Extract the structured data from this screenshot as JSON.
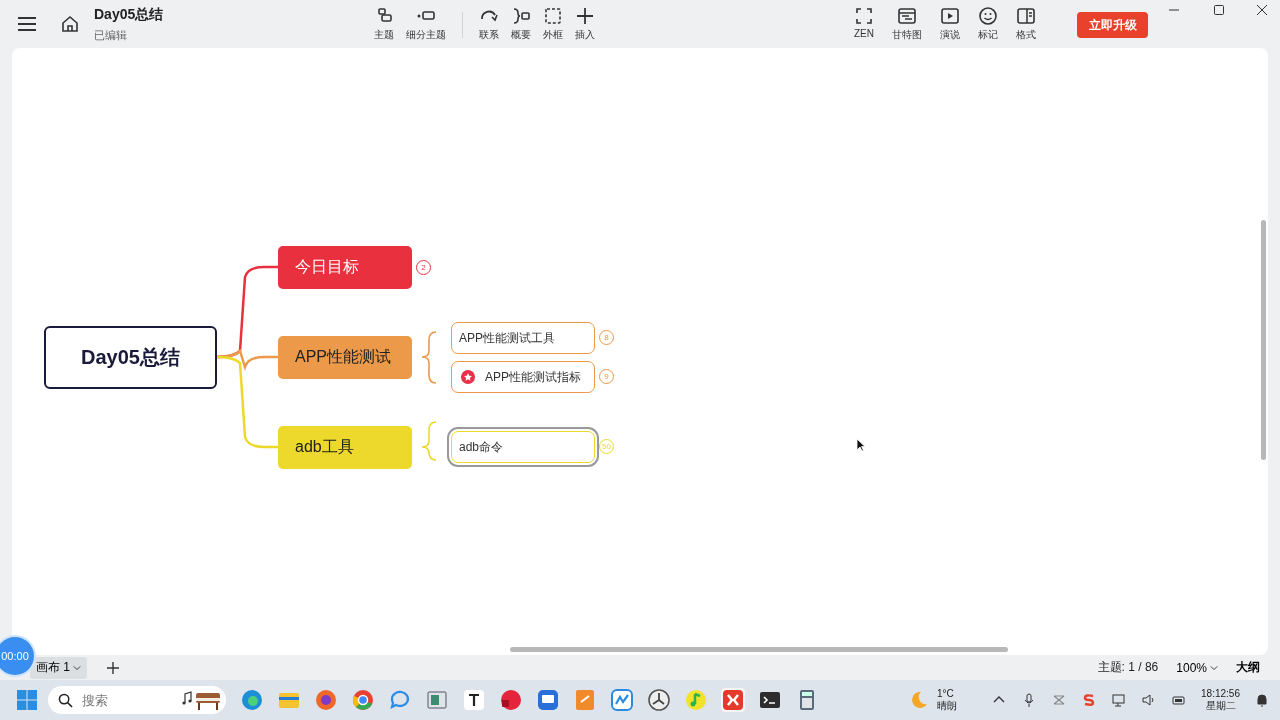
{
  "window": {
    "title": "Day05总结",
    "subtitle": "已编辑"
  },
  "toolbar": {
    "groups": [
      [
        {
          "label": "主题"
        },
        {
          "label": "细分主题"
        }
      ],
      [
        {
          "label": "联系"
        },
        {
          "label": "概要"
        },
        {
          "label": "外框"
        },
        {
          "label": "插入"
        }
      ]
    ]
  },
  "right_tools": [
    {
      "label": "ZEN"
    },
    {
      "label": "甘特图"
    },
    {
      "label": "演说"
    },
    {
      "label": "标记"
    },
    {
      "label": "格式"
    }
  ],
  "upgrade_button": "立即升级",
  "mindmap": {
    "root": "Day05总结",
    "branches": [
      {
        "label": "今日目标",
        "color": "#e8303f",
        "count": "2"
      },
      {
        "label": "APP性能测试",
        "color": "#ec9a4a",
        "children": [
          {
            "label": "APP性能测试工具",
            "count": "8",
            "flagged": false,
            "selected": false
          },
          {
            "label": "APP性能测试指标",
            "count": "9",
            "flagged": true,
            "selected": false
          }
        ]
      },
      {
        "label": "adb工具",
        "color": "#ecd92b",
        "children": [
          {
            "label": "adb命令",
            "count": "50",
            "flagged": false,
            "selected": true
          }
        ]
      }
    ]
  },
  "bottom_bar": {
    "timer": "00:00",
    "sheet_tab": "画布 1",
    "topic_count": "主题: 1 / 86",
    "zoom": "100%",
    "outline": "大纲"
  },
  "taskbar": {
    "search_placeholder": "搜索",
    "weather_temp": "1°C",
    "weather_desc": "晴朗",
    "time": "18:12:56",
    "day": "星期二"
  }
}
